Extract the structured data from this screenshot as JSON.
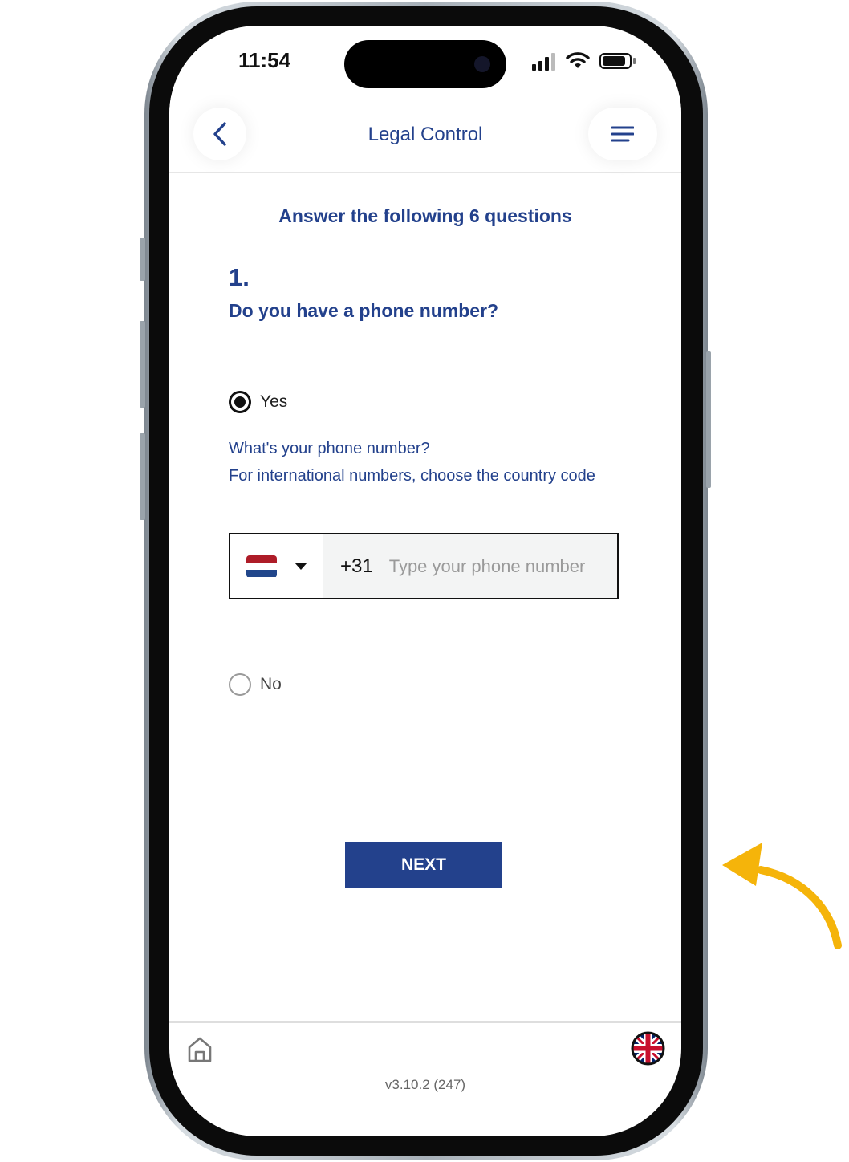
{
  "status_bar": {
    "time": "11:54"
  },
  "header": {
    "back_icon": "chevron-left-icon",
    "title": "Legal Control",
    "menu_icon": "hamburger-menu-icon"
  },
  "page": {
    "heading": "Answer the following 6 questions",
    "question_number": "1.",
    "question_text": "Do you have a phone number?"
  },
  "options": [
    {
      "label": "Yes",
      "selected": true
    },
    {
      "label": "No",
      "selected": false
    }
  ],
  "phone_prompt": {
    "line1": "What's your phone number?",
    "line2": "For international numbers, choose the country code"
  },
  "phone_input": {
    "country_flag": "netherlands-flag",
    "dial_code": "+31",
    "value": "",
    "placeholder": "Type your phone number"
  },
  "actions": {
    "next_label": "NEXT"
  },
  "footer": {
    "home_icon": "home-icon",
    "language_icon": "uk-flag-icon",
    "version": "v3.10.2 (247)"
  },
  "colors": {
    "brand_blue": "#23418c",
    "annotation_arrow": "#f5b40a"
  }
}
